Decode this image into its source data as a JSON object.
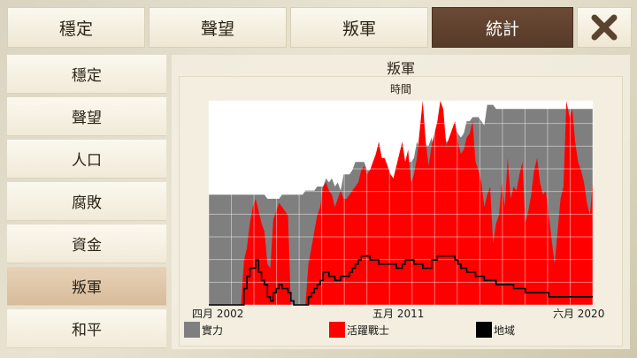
{
  "tabs": [
    {
      "label": "穩定",
      "active": false
    },
    {
      "label": "聲望",
      "active": false
    },
    {
      "label": "叛軍",
      "active": false
    },
    {
      "label": "統計",
      "active": true
    }
  ],
  "close_icon": "close-x-icon",
  "sidebar": {
    "items": [
      {
        "label": "穩定",
        "active": false
      },
      {
        "label": "聲望",
        "active": false
      },
      {
        "label": "人口",
        "active": false
      },
      {
        "label": "腐敗",
        "active": false
      },
      {
        "label": "資金",
        "active": false
      },
      {
        "label": "叛軍",
        "active": true
      },
      {
        "label": "和平",
        "active": false
      }
    ]
  },
  "panel": {
    "title": "叛軍"
  },
  "colors": {
    "strength": "#7f7f7f",
    "fighters": "#ff0000",
    "territory": "#000000",
    "active_tab": "#5e4130",
    "active_sidebar": "#dcc1a2"
  },
  "chart_data": {
    "type": "area",
    "title": "時間",
    "x_tick_labels": [
      "四月 2002",
      "五月 2011",
      "六月 2020"
    ],
    "x_ticks_at": [
      0.03,
      0.5,
      0.97
    ],
    "ylim": [
      0,
      100
    ],
    "grid": true,
    "legend_position": "bottom",
    "series": [
      {
        "name": "實力",
        "color": "#7f7f7f",
        "values": [
          54,
          54,
          54,
          54,
          54,
          54,
          54,
          54,
          54,
          54,
          54,
          54,
          54,
          54,
          54,
          54,
          54,
          54,
          54,
          54,
          52,
          52,
          52,
          52,
          52,
          54,
          54,
          54,
          54,
          54,
          54,
          54,
          54,
          56,
          56,
          56,
          56,
          58,
          58,
          58,
          62,
          60,
          62,
          58,
          60,
          56,
          64,
          64,
          64,
          66,
          70,
          70,
          70,
          70,
          66,
          66,
          66,
          66,
          64,
          64,
          64,
          62,
          62,
          62,
          68,
          72,
          72,
          70,
          70,
          70,
          72,
          80,
          76,
          74,
          78,
          78,
          82,
          74,
          80,
          82,
          86,
          80,
          80,
          86,
          86,
          84,
          82,
          84,
          90,
          90,
          92,
          92,
          92,
          90,
          88,
          98,
          98,
          98,
          96,
          96,
          96,
          96,
          96,
          96,
          96,
          96,
          96,
          96,
          96,
          96,
          96,
          96,
          96,
          96,
          96,
          96,
          96,
          96,
          96,
          96,
          96,
          96,
          96,
          96,
          96,
          96,
          96,
          96,
          96,
          96,
          96,
          96
        ]
      },
      {
        "name": "活躍戰士",
        "color": "#ff0000",
        "values": [
          0,
          0,
          0,
          0,
          0,
          0,
          0,
          0,
          0,
          0,
          0,
          0,
          22,
          28,
          40,
          48,
          52,
          46,
          40,
          36,
          20,
          18,
          42,
          46,
          50,
          48,
          46,
          44,
          0,
          0,
          0,
          0,
          0,
          0,
          20,
          28,
          36,
          44,
          48,
          58,
          60,
          56,
          54,
          48,
          52,
          56,
          52,
          52,
          54,
          56,
          58,
          60,
          66,
          68,
          64,
          66,
          70,
          74,
          80,
          72,
          72,
          68,
          64,
          62,
          68,
          74,
          80,
          70,
          76,
          60,
          64,
          72,
          86,
          100,
          80,
          68,
          78,
          84,
          90,
          100,
          96,
          78,
          82,
          86,
          90,
          80,
          74,
          76,
          82,
          84,
          90,
          70,
          66,
          60,
          48,
          54,
          58,
          30,
          40,
          44,
          60,
          48,
          72,
          52,
          58,
          56,
          64,
          70,
          40,
          46,
          54,
          66,
          72,
          60,
          54,
          56,
          44,
          32,
          20,
          36,
          52,
          58,
          100,
          92,
          96,
          80,
          70,
          66,
          60,
          50,
          44,
          60
        ]
      },
      {
        "name": "地域",
        "color": "#000000",
        "values": [
          0,
          0,
          0,
          0,
          0,
          0,
          0,
          0,
          0,
          0,
          0,
          0,
          8,
          14,
          18,
          18,
          22,
          16,
          12,
          10,
          4,
          2,
          6,
          8,
          10,
          8,
          8,
          6,
          2,
          0,
          0,
          0,
          0,
          0,
          4,
          6,
          8,
          10,
          12,
          16,
          16,
          14,
          14,
          12,
          12,
          14,
          14,
          14,
          16,
          18,
          20,
          22,
          24,
          24,
          24,
          22,
          22,
          22,
          20,
          20,
          20,
          20,
          20,
          20,
          18,
          18,
          20,
          22,
          22,
          22,
          20,
          20,
          20,
          18,
          18,
          18,
          22,
          22,
          24,
          24,
          24,
          24,
          24,
          24,
          22,
          20,
          18,
          18,
          16,
          16,
          16,
          14,
          14,
          14,
          12,
          12,
          12,
          12,
          10,
          10,
          10,
          10,
          10,
          10,
          8,
          8,
          8,
          8,
          6,
          6,
          6,
          6,
          6,
          6,
          6,
          6,
          4,
          4,
          4,
          4,
          4,
          4,
          4,
          4,
          4,
          4,
          4,
          4,
          4,
          4,
          4,
          4
        ]
      }
    ]
  }
}
